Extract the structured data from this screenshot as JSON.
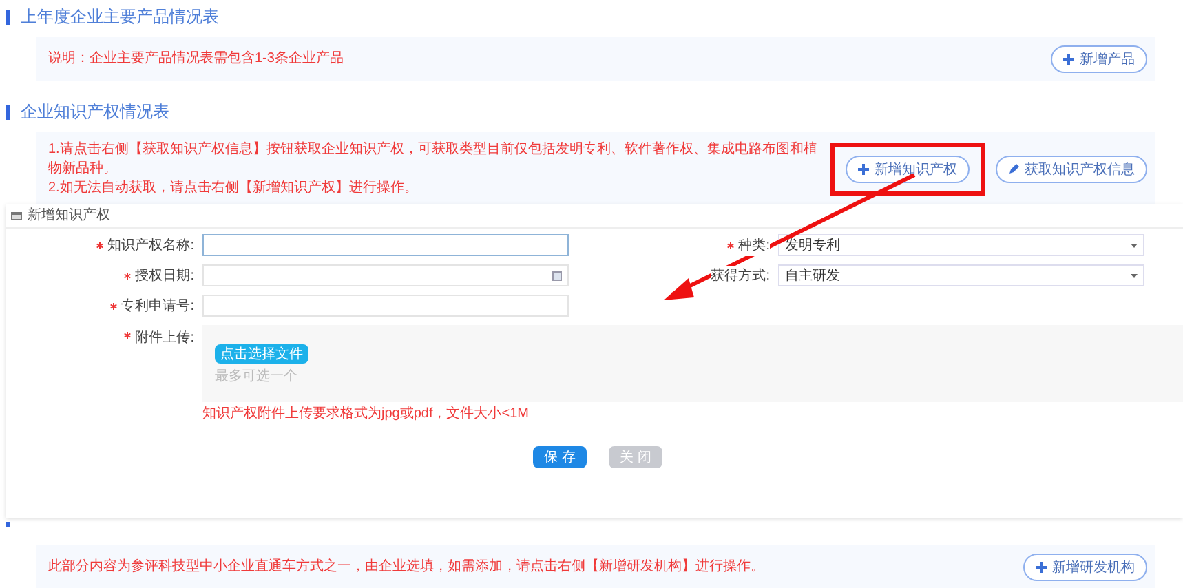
{
  "sections": [
    {
      "title": "上年度企业主要产品情况表",
      "notes": [
        "说明：企业主要产品情况表需包含1-3条企业产品"
      ],
      "buttons": [
        {
          "label": "新增产品",
          "kind": "add",
          "highlighted": false
        }
      ]
    },
    {
      "title": "企业知识产权情况表",
      "notes": [
        "1.请点击右侧【获取知识产权信息】按钮获取企业知识产权，可获取类型目前仅包括发明专利、软件著作权、集成电路布图和植物新品种。",
        "2.如无法自动获取，请点击右侧【新增知识产权】进行操作。"
      ],
      "buttons": [
        {
          "label": "新增知识产权",
          "kind": "add",
          "highlighted": true
        },
        {
          "label": "获取知识产权信息",
          "kind": "fetch",
          "highlighted": false
        }
      ]
    },
    {
      "notes": [
        "此部分内容为参评科技型中小企业直通车方式之一，由企业选填，如需添加，请点击右侧【新增研发机构】进行操作。"
      ],
      "buttons": [
        {
          "label": "新增研发机构",
          "kind": "add",
          "highlighted": false
        }
      ]
    }
  ],
  "dialog": {
    "title": "新增知识产权",
    "left_fields": [
      {
        "kind": "text",
        "label": "知识产权名称:",
        "required": true,
        "focused": true
      },
      {
        "kind": "date",
        "label": "授权日期:",
        "required": true,
        "focused": false
      },
      {
        "kind": "text",
        "label": "专利申请号:",
        "required": true,
        "focused": false
      }
    ],
    "right_fields": [
      {
        "kind": "select",
        "label": "种类:",
        "required": true,
        "value": "发明专利"
      },
      {
        "kind": "select",
        "label": "获得方式:",
        "required": false,
        "value": "自主研发"
      }
    ],
    "upload": {
      "label": "附件上传:",
      "required": true,
      "button": "点击选择文件",
      "hint": "最多可选一个",
      "rule": "知识产权附件上传要求格式为jpg或pdf，文件大小<1M"
    },
    "actions": [
      {
        "label": "保 存",
        "disabled": false
      },
      {
        "label": "关 闭",
        "disabled": true
      }
    ]
  }
}
